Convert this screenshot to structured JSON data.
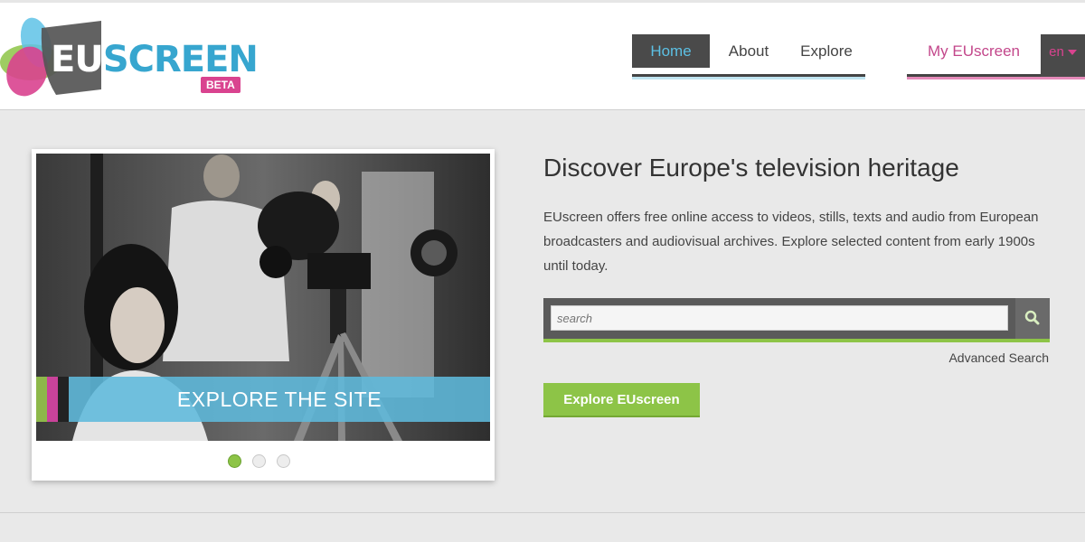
{
  "logo": {
    "part1": "EU",
    "part2": "SCREEN",
    "badge": "BETA"
  },
  "nav": {
    "items": [
      {
        "label": "Home",
        "active": true
      },
      {
        "label": "About"
      },
      {
        "label": "Explore"
      }
    ],
    "my": "My EUscreen",
    "lang": "en"
  },
  "slideshow": {
    "banner": "EXPLORE THE SITE",
    "dots_total": 3,
    "active_dot": 1
  },
  "hero": {
    "title": "Discover Europe's television heritage",
    "description": "EUscreen offers free online access to videos, stills, texts and audio from European broadcasters and audiovisual archives. Explore selected content from early 1900s until today."
  },
  "search": {
    "placeholder": "search",
    "advanced": "Advanced Search"
  },
  "cta": {
    "label": "Explore EUscreen"
  },
  "colors": {
    "blue": "#37a6cf",
    "pink": "#d9438f",
    "green": "#8dc447",
    "dark": "#4a4a4a"
  },
  "icons": {
    "search": "search-icon",
    "lang_caret": "chevron-down-icon"
  }
}
